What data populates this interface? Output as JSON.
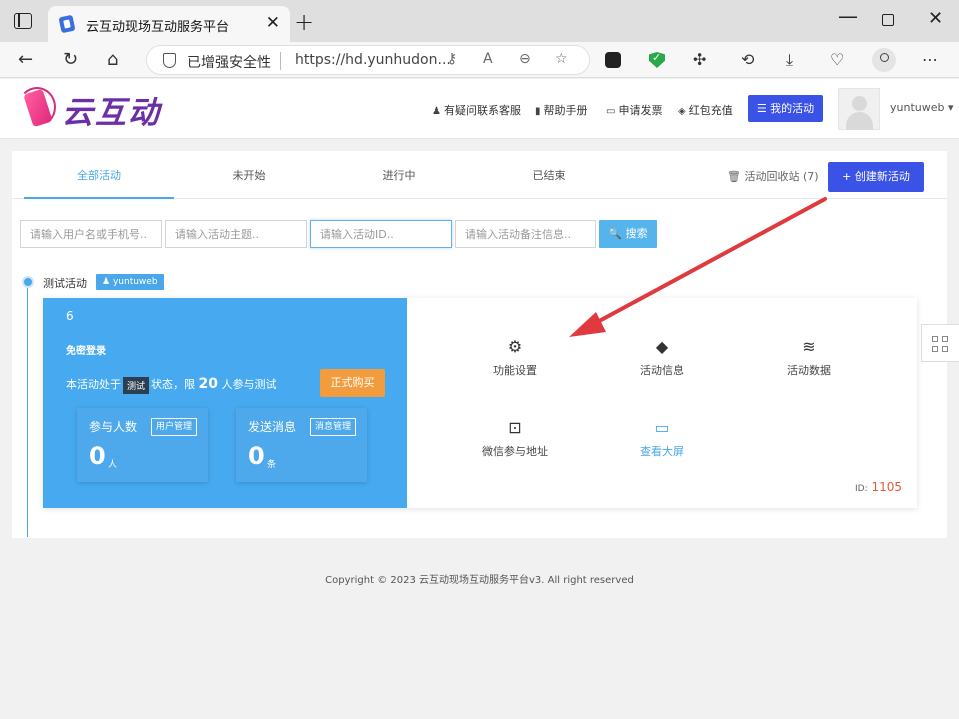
{
  "browser": {
    "tab_title": "云互动现场互动服务平台",
    "security_label": "已增强安全性",
    "url": "https://hd.yunhudon...",
    "tab_close": "✕",
    "new_tab": "+"
  },
  "header": {
    "logo_text": "云互动",
    "links": [
      {
        "icon": "person-plus-icon",
        "glyph": "♟",
        "label": "有疑问联系客服"
      },
      {
        "icon": "book-icon",
        "glyph": "▮",
        "label": "帮助手册"
      },
      {
        "icon": "printer-icon",
        "glyph": "▭",
        "label": "申请发票"
      },
      {
        "icon": "shield-check-icon",
        "glyph": "◈",
        "label": "红包充值"
      }
    ],
    "my_activity": "☰ 我的活动",
    "username": "yuntuweb ▾"
  },
  "tabs": [
    "全部活动",
    "未开始",
    "进行中",
    "已结束"
  ],
  "active_tab": 0,
  "recycle": "🗑 活动回收站 (7)",
  "create_button": "+ 创建新活动",
  "filters": {
    "user": "请输入用户名或手机号..",
    "theme": "请输入活动主题..",
    "id": "请输入活动ID..",
    "note": "请输入活动备注信息..",
    "search": "🔍 搜索"
  },
  "activity": {
    "name": "测试活动",
    "owner": "yuntuweb",
    "number": "6",
    "subtitle": "免密登录",
    "status_prefix": "本活动处于",
    "status_tag": "测试",
    "status_mid": "状态，限",
    "limit": "20",
    "status_suffix": "人参与测试",
    "buy": "正式购买",
    "stats": [
      {
        "label": "参与人数",
        "button": "用户管理",
        "value": "0",
        "unit": "人"
      },
      {
        "label": "发送消息",
        "button": "消息管理",
        "value": "0",
        "unit": "条"
      }
    ],
    "functions": [
      {
        "icon": "gear-icon",
        "glyph": "⚙",
        "label": "功能设置"
      },
      {
        "icon": "tag-icon",
        "glyph": "◆",
        "label": "活动信息"
      },
      {
        "icon": "database-icon",
        "glyph": "≋",
        "label": "活动数据"
      },
      {
        "icon": "scan-icon",
        "glyph": "⊡",
        "label": "微信参与地址"
      },
      {
        "icon": "laptop-icon",
        "glyph": "▭",
        "label": "查看大屏"
      }
    ],
    "id_label": "ID:",
    "id_value": "1105"
  },
  "copyright": "Copyright © 2023 云互动现场互动服务平台v3. All right reserved",
  "colors": {
    "primary": "#3a53e6",
    "accent_blue": "#47aaf0",
    "orange": "#f39c3e",
    "arrow_red": "#e0393e"
  }
}
